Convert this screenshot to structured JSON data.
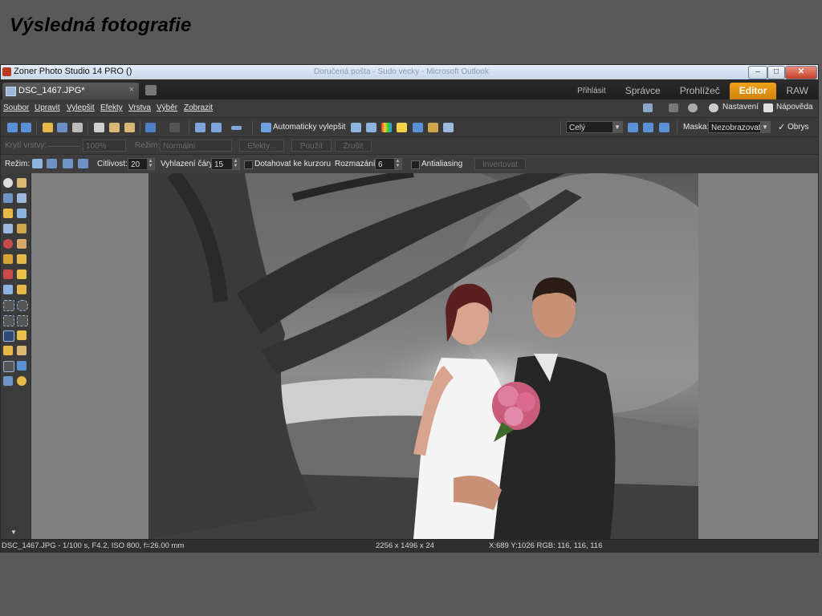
{
  "slide": {
    "title": "Výsledná fotografie"
  },
  "window": {
    "title": "Zoner Photo Studio 14 PRO  ()",
    "ghost_title": "Doručená pošta - Sudo vecky - Microsoft Outlook",
    "minimize": "–",
    "maximize": "□",
    "close": "✕"
  },
  "document_tab": {
    "name": "DSC_1467.JPG*",
    "close": "×"
  },
  "module_tabs": [
    "Přihlásit",
    "Správce",
    "Prohlížeč",
    "Editor",
    "RAW"
  ],
  "active_module": "Editor",
  "menu": {
    "items": [
      "Soubor",
      "Upravit",
      "Vylepšit",
      "Efekty",
      "Vrstva",
      "Výběr",
      "Zobrazit"
    ],
    "settings": "Nastavení",
    "help": "Nápověda"
  },
  "toolbar": {
    "auto_enhance": "Automaticky vylepšit",
    "zoom_value": "Celý",
    "mask_label": "Maska:",
    "mask_value": "Nezobrazovat",
    "outline_label": "Obrys",
    "outline_checked": true
  },
  "layer_bar": {
    "opacity_label": "Krytí vrstvy:",
    "opacity_value": "100%",
    "mode_label": "Režim:",
    "mode_value": "Normální",
    "effects_btn": "Efekty...",
    "apply_btn": "Použít",
    "cancel_btn": "Zrušit"
  },
  "tool_options": {
    "mode_label": "Režim:",
    "sensitivity_label": "Citlivost:",
    "sensitivity_value": "20",
    "smoothing_label": "Vyhlazení čáry:",
    "smoothing_value": "15",
    "snap_label": "Dotahovat ke kurzoru",
    "blur_label": "Rozmazání:",
    "blur_value": "6",
    "antialias_label": "Antialiasing",
    "invert_btn": "Invertovat"
  },
  "status": {
    "file_info": "DSC_1467.JPG - 1/100 s, F4.2, ISO 800, f=26.00 mm",
    "dimensions": "2256 x 1496 x 24",
    "cursor": "X:689 Y:1026   RGB: 116, 116, 116"
  },
  "colors": {
    "accent": "#e39313",
    "app_bg": "#3b3b3b",
    "canvas_bg": "#808080",
    "slide_bg": "#595959"
  },
  "icons": [
    "back-arrow-icon",
    "forward-arrow-icon",
    "open-folder-icon",
    "save-icon",
    "print-icon",
    "copy-icon",
    "paste-icon",
    "undo-icon",
    "redo-icon",
    "settings-gear-icon",
    "help-icon",
    "zoom-icon",
    "hand-icon",
    "lasso-icon",
    "brush-icon"
  ]
}
